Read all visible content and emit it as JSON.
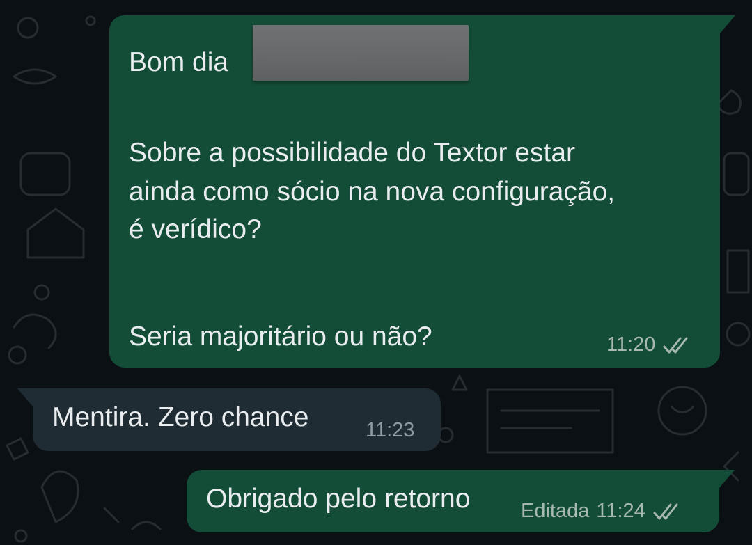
{
  "chat": {
    "messages": [
      {
        "direction": "outgoing",
        "lines": [
          "Bom dia",
          "Sobre a possibilidade do Textor estar",
          "ainda como sócio na nova configuração,",
          "é verídico?",
          "Seria majoritário ou não?"
        ],
        "time": "11:20",
        "status_icon": "double-check-icon"
      },
      {
        "direction": "incoming",
        "text": "Mentira. Zero chance",
        "time": "11:23"
      },
      {
        "direction": "outgoing",
        "text": "Obrigado pelo retorno",
        "edited_label": "Editada",
        "time": "11:24",
        "status_icon": "double-check-icon"
      }
    ]
  },
  "colors": {
    "background": "#0b1014",
    "outgoing_bubble": "#144d37",
    "incoming_bubble": "#1f2c33",
    "text": "#e9edef",
    "meta_outgoing": "#a7b8b0",
    "meta_incoming": "#8f9ba2"
  }
}
